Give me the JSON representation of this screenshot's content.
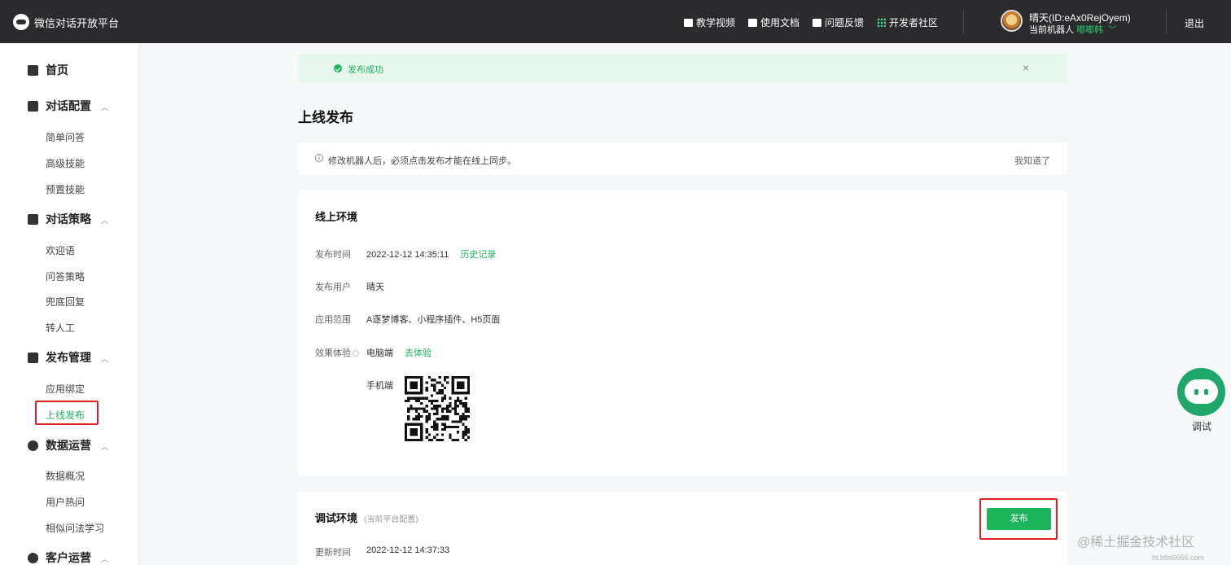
{
  "header": {
    "logo_text": "微信对话开放平台",
    "nav": [
      {
        "label": "教学视频",
        "icon": "video-icon"
      },
      {
        "label": "使用文档",
        "icon": "document-icon"
      },
      {
        "label": "问题反馈",
        "icon": "feedback-icon"
      },
      {
        "label": "开发者社区",
        "icon": "community-icon"
      }
    ],
    "user_name": "晴天(ID:eAx0RejOyem)",
    "current_bot_label": "当前机器人",
    "current_bot_name": "嘟嘟韩",
    "logout": "退出"
  },
  "sidebar": {
    "home": "首页",
    "groups": [
      {
        "label": "对话配置",
        "icon": "chat-icon",
        "items": [
          "简单问答",
          "高级技能",
          "预置技能"
        ]
      },
      {
        "label": "对话策略",
        "icon": "list-icon",
        "items": [
          "欢迎语",
          "问答策略",
          "兜底回复",
          "转人工"
        ]
      },
      {
        "label": "发布管理",
        "icon": "send-icon",
        "items": [
          "应用绑定",
          "上线发布"
        ]
      },
      {
        "label": "数据运营",
        "icon": "pie-chart-icon",
        "items": [
          "数据概况",
          "用户热问",
          "相似问法学习"
        ]
      },
      {
        "label": "客户运营",
        "icon": "user-icon",
        "items": []
      }
    ],
    "active_item": "上线发布"
  },
  "alert": {
    "message": "发布成功",
    "close": "×"
  },
  "page_title": "上线发布",
  "notice": {
    "text": "修改机器人后，必须点击发布才能在线上同步。",
    "ack": "我知道了"
  },
  "online": {
    "title": "线上环境",
    "publish_time_label": "发布时间",
    "publish_time": "2022-12-12 14:35:11",
    "history_link": "历史记录",
    "publish_user_label": "发布用户",
    "publish_user": "晴天",
    "scope_label": "应用范围",
    "scope": "A逐梦博客、小程序插件、H5页面",
    "experience_label": "效果体验",
    "desktop_label": "电脑端",
    "try_link": "去体验",
    "mobile_label": "手机端"
  },
  "debug_env": {
    "title": "调试环境",
    "subtitle": "(当前平台配置)",
    "update_time_label": "更新时间",
    "update_time": "2022-12-12 14:37:33",
    "publish_button": "发布"
  },
  "float": {
    "label": "调试"
  },
  "watermark": {
    "text": "@稀土掘金技术社区",
    "site": "ht.bbs6666.com"
  },
  "colors": {
    "accent": "#1bb55c",
    "topbar": "#2b2b2e",
    "highlight": "#e02020"
  }
}
